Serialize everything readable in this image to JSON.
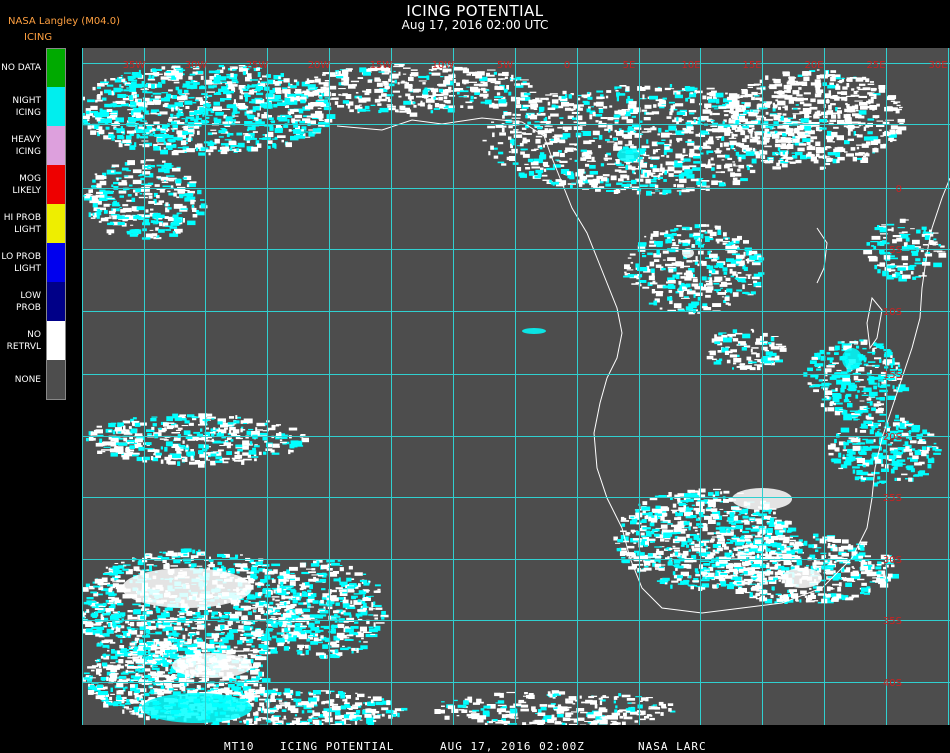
{
  "header": {
    "title": "ICING POTENTIAL",
    "datetime": "Aug 17, 2016 02:00 UTC",
    "producer": "NASA Langley (M04.0)",
    "product": "ICING"
  },
  "legend": [
    {
      "label": "NO DATA",
      "color": "#00aa00"
    },
    {
      "label": "NIGHT\nICING",
      "color": "#00eeee"
    },
    {
      "label": "HEAVY\nICING",
      "color": "#dda0dd"
    },
    {
      "label": "MOG\nLIKELY",
      "color": "#ee0000"
    },
    {
      "label": "HI PROB\nLIGHT",
      "color": "#eeee00"
    },
    {
      "label": "LO PROB\nLIGHT",
      "color": "#0000ee"
    },
    {
      "label": "LOW\nPROB",
      "color": "#000088"
    },
    {
      "label": "NO\nRETRVL",
      "color": "#ffffff"
    },
    {
      "label": "NONE",
      "color": "#4d4d4d"
    }
  ],
  "map": {
    "background": "#4d4d4d",
    "grid_color": "#30d0d0",
    "label_color": "#cc2222",
    "icing_color": "#00ffff",
    "cloud_color": "#ffffff",
    "lon_labels": [
      "35W",
      "30W",
      "25W",
      "20W",
      "15W",
      "10W",
      "5W",
      "0",
      "5E",
      "10E",
      "15E",
      "20E",
      "25E",
      "30E",
      "35E"
    ],
    "lat_labels": [
      "0",
      "5S",
      "10S",
      "15S",
      "20S",
      "25S",
      "30S",
      "35S",
      "40S"
    ]
  },
  "footer": {
    "id": "MT10",
    "product": "ICING POTENTIAL",
    "date": "AUG 17, 2016 02:00Z",
    "org": "NASA LARC"
  }
}
